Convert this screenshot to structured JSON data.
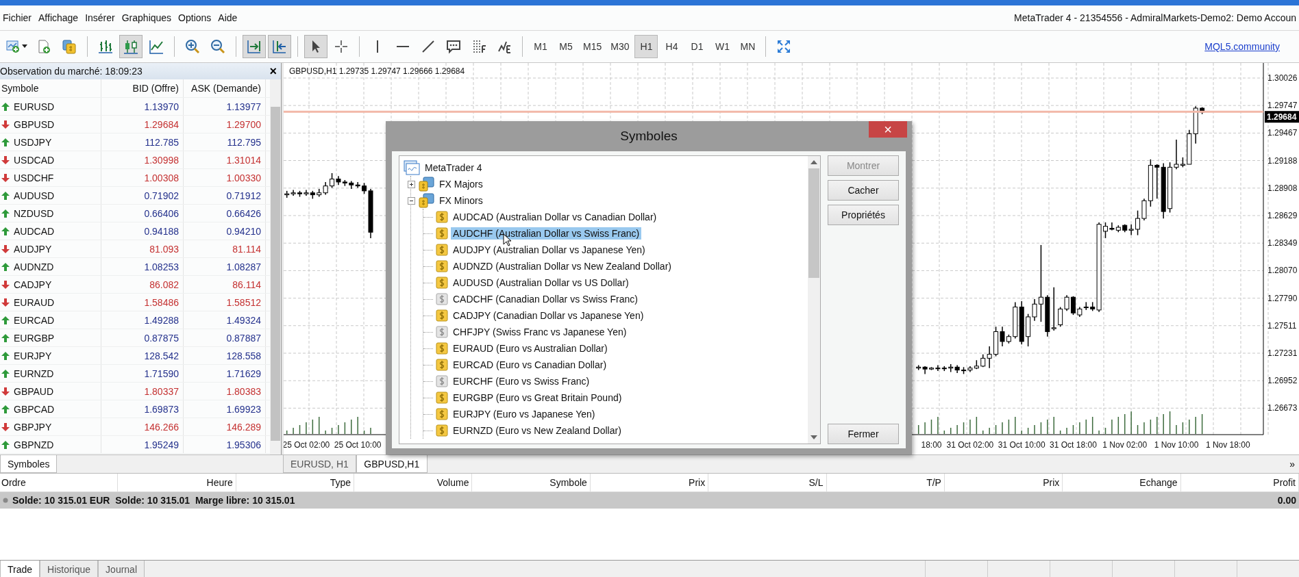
{
  "window": {
    "title": "MetaTrader 4 - 21354556 - AdmiralMarkets-Demo2: Demo Accoun"
  },
  "menu": [
    "Fichier",
    "Affichage",
    "Insérer",
    "Graphiques",
    "Options",
    "Aide"
  ],
  "toolbar": {
    "buttons": [
      {
        "selected": false
      },
      {
        "selected": false
      },
      {
        "selected": false
      },
      {
        "selected": false
      },
      {
        "selected": true
      },
      {
        "selected": false
      },
      {
        "selected": false
      },
      {
        "selected": false
      },
      {
        "selected": true
      },
      {
        "selected": true
      },
      {
        "selected": true
      },
      {
        "selected": false
      },
      {
        "selected": false
      },
      {
        "selected": false
      },
      {
        "selected": false
      },
      {
        "selected": false
      },
      {
        "selected": false
      },
      {
        "selected": false
      },
      {
        "selected": false
      }
    ],
    "timeframes": [
      {
        "label": "M1",
        "selected": false
      },
      {
        "label": "M5",
        "selected": false
      },
      {
        "label": "M15",
        "selected": false
      },
      {
        "label": "M30",
        "selected": false
      },
      {
        "label": "H1",
        "selected": true
      },
      {
        "label": "H4",
        "selected": false
      },
      {
        "label": "D1",
        "selected": false
      },
      {
        "label": "W1",
        "selected": false
      },
      {
        "label": "MN",
        "selected": false
      }
    ],
    "link": "MQL5.community"
  },
  "market_watch": {
    "title": "Observation du marché: 18:09:23",
    "close": "×",
    "columns": [
      "Symbole",
      "BID (Offre)",
      "ASK (Demande)"
    ],
    "rows": [
      {
        "symbol": "EURUSD",
        "bid": "1.13970",
        "ask": "1.13977",
        "rising": true
      },
      {
        "symbol": "GBPUSD",
        "bid": "1.29684",
        "ask": "1.29700",
        "rising": false
      },
      {
        "symbol": "USDJPY",
        "bid": "112.785",
        "ask": "112.795",
        "rising": true
      },
      {
        "symbol": "USDCAD",
        "bid": "1.30998",
        "ask": "1.31014",
        "rising": false
      },
      {
        "symbol": "USDCHF",
        "bid": "1.00308",
        "ask": "1.00330",
        "rising": false
      },
      {
        "symbol": "AUDUSD",
        "bid": "0.71902",
        "ask": "0.71912",
        "rising": true
      },
      {
        "symbol": "NZDUSD",
        "bid": "0.66406",
        "ask": "0.66426",
        "rising": true
      },
      {
        "symbol": "AUDCAD",
        "bid": "0.94188",
        "ask": "0.94210",
        "rising": true
      },
      {
        "symbol": "AUDJPY",
        "bid": "81.093",
        "ask": "81.114",
        "rising": false
      },
      {
        "symbol": "AUDNZD",
        "bid": "1.08253",
        "ask": "1.08287",
        "rising": true
      },
      {
        "symbol": "CADJPY",
        "bid": "86.082",
        "ask": "86.114",
        "rising": false
      },
      {
        "symbol": "EURAUD",
        "bid": "1.58486",
        "ask": "1.58512",
        "rising": false
      },
      {
        "symbol": "EURCAD",
        "bid": "1.49288",
        "ask": "1.49324",
        "rising": true
      },
      {
        "symbol": "EURGBP",
        "bid": "0.87875",
        "ask": "0.87887",
        "rising": true
      },
      {
        "symbol": "EURJPY",
        "bid": "128.542",
        "ask": "128.558",
        "rising": true
      },
      {
        "symbol": "EURNZD",
        "bid": "1.71590",
        "ask": "1.71629",
        "rising": true
      },
      {
        "symbol": "GBPAUD",
        "bid": "1.80337",
        "ask": "1.80383",
        "rising": false
      },
      {
        "symbol": "GBPCAD",
        "bid": "1.69873",
        "ask": "1.69923",
        "rising": true
      },
      {
        "symbol": "GBPJPY",
        "bid": "146.266",
        "ask": "146.289",
        "rising": false
      },
      {
        "symbol": "GBPNZD",
        "bid": "1.95249",
        "ask": "1.95306",
        "rising": true
      }
    ]
  },
  "left_tabs": [
    {
      "label": "Symboles",
      "selected": true
    }
  ],
  "chart": {
    "header": "GBPUSD,H1 1.29735 1.29747 1.29666 1.29684",
    "chart_data": {
      "type": "candlestick",
      "categories": [
        null,
        null,
        null,
        "25 Oct 02:00",
        null,
        null,
        null,
        null,
        null,
        null,
        null,
        "25 Oct 10:00",
        null,
        null,
        null,
        null,
        null,
        null,
        null,
        null,
        null,
        null,
        null,
        null,
        null,
        null,
        null,
        null,
        null,
        null,
        null,
        null,
        null,
        null,
        null,
        null,
        null,
        null,
        null,
        null,
        null,
        null,
        null,
        null,
        null,
        null,
        null,
        null,
        null,
        null,
        null,
        null,
        null,
        null,
        null,
        null,
        null,
        null,
        null,
        null,
        null,
        null,
        null,
        null,
        null,
        null,
        null,
        null,
        null,
        null,
        null,
        null,
        null,
        null,
        null,
        null,
        null,
        null,
        null,
        null,
        null,
        null,
        null,
        null,
        null,
        null,
        null,
        null,
        null,
        null,
        null,
        null,
        null,
        null,
        null,
        null,
        null,
        null,
        null,
        null,
        "18:00",
        null,
        null,
        null,
        null,
        null,
        "31 Oct 02:00",
        null,
        null,
        null,
        null,
        null,
        null,
        null,
        "31 Oct 10:00",
        null,
        null,
        null,
        null,
        null,
        null,
        null,
        "31 Oct 18:00",
        null,
        null,
        null,
        null,
        null,
        null,
        null,
        "1 Nov 02:00",
        null,
        null,
        null,
        null,
        null,
        null,
        null,
        "1 Nov 10:00",
        null,
        null,
        null,
        null,
        null,
        null,
        null,
        "1 Nov 18:00",
        null,
        null,
        null,
        null,
        null
      ],
      "ohlc": [
        [
          1.2884,
          1.2888,
          1.2881,
          1.2885
        ],
        [
          1.2885,
          1.2889,
          1.2883,
          1.2886
        ],
        [
          1.2886,
          1.2888,
          1.2882,
          1.2885
        ],
        [
          1.2885,
          1.2889,
          1.2883,
          1.2886
        ],
        [
          1.2886,
          1.2888,
          1.288,
          1.2884
        ],
        [
          1.2884,
          1.289,
          1.2882,
          1.2886
        ],
        [
          1.2886,
          1.2897,
          1.2884,
          1.2893
        ],
        [
          1.2893,
          1.2906,
          1.2891,
          1.29
        ],
        [
          1.29,
          1.2903,
          1.2894,
          1.2897
        ],
        [
          1.2897,
          1.2899,
          1.2893,
          1.2896
        ],
        [
          1.2896,
          1.2898,
          1.289,
          1.2894
        ],
        [
          1.2894,
          1.2897,
          1.2891,
          1.2893
        ],
        [
          1.2893,
          1.2896,
          1.2885,
          1.2888
        ],
        [
          1.2888,
          1.289,
          1.284,
          1.2846
        ],
        null,
        null,
        null,
        null,
        null,
        null,
        null,
        null,
        null,
        null,
        null,
        null,
        null,
        null,
        null,
        null,
        null,
        null,
        null,
        null,
        null,
        null,
        null,
        null,
        null,
        null,
        null,
        null,
        null,
        null,
        null,
        null,
        null,
        null,
        null,
        null,
        null,
        null,
        null,
        null,
        null,
        null,
        null,
        null,
        null,
        null,
        null,
        null,
        null,
        null,
        null,
        null,
        null,
        null,
        null,
        null,
        null,
        null,
        null,
        null,
        null,
        null,
        null,
        null,
        null,
        null,
        null,
        null,
        null,
        null,
        null,
        null,
        null,
        null,
        null,
        null,
        null,
        null,
        null,
        null,
        null,
        null,
        null,
        null,
        [
          1.2708,
          1.2711,
          1.2706,
          1.2709
        ],
        [
          1.2709,
          1.271,
          1.2702,
          1.2707
        ],
        [
          1.2707,
          1.2709,
          1.2706,
          1.2708
        ],
        [
          1.2708,
          1.2711,
          1.2705,
          1.2708
        ],
        [
          1.2708,
          1.271,
          1.2705,
          1.2708
        ],
        [
          1.2708,
          1.2712,
          1.2704,
          1.2709
        ],
        [
          1.2709,
          1.2711,
          1.2703,
          1.2706
        ],
        [
          1.2706,
          1.2709,
          1.2702,
          1.2706
        ],
        [
          1.2706,
          1.271,
          1.2704,
          1.2708
        ],
        [
          1.2708,
          1.2716,
          1.2707,
          1.271
        ],
        [
          1.271,
          1.2722,
          1.2709,
          1.2718
        ],
        [
          1.2718,
          1.273,
          1.2708,
          1.2722
        ],
        [
          1.2722,
          1.275,
          1.272,
          1.2745
        ],
        [
          1.2745,
          1.275,
          1.273,
          1.2735
        ],
        [
          1.2735,
          1.2742,
          1.2733,
          1.274
        ],
        [
          1.274,
          1.2775,
          1.2738,
          1.277
        ],
        [
          1.277,
          1.2776,
          1.2732,
          1.2735
        ],
        [
          1.274,
          1.2763,
          1.273,
          1.276
        ],
        [
          1.276,
          1.2778,
          1.2756,
          1.2773
        ],
        [
          1.2773,
          1.2833,
          1.2755,
          1.278
        ],
        [
          1.278,
          1.2782,
          1.274,
          1.2745
        ],
        [
          1.2748,
          1.279,
          1.2746,
          1.2749
        ],
        [
          1.2752,
          1.277,
          1.275,
          1.2768
        ],
        [
          1.2768,
          1.2782,
          1.2766,
          1.278
        ],
        [
          1.278,
          1.2781,
          1.2762,
          1.2764
        ],
        [
          1.2762,
          1.277,
          1.276,
          1.2768
        ],
        [
          1.277,
          1.2775,
          1.2767,
          1.277
        ],
        [
          1.277,
          1.2775,
          1.2766,
          1.2768
        ],
        [
          1.2767,
          1.2856,
          1.2765,
          1.2854
        ],
        [
          1.2847,
          1.2856,
          1.284,
          1.2852
        ],
        [
          1.285,
          1.2856,
          1.2848,
          1.2849
        ],
        [
          1.2848,
          1.2853,
          1.2846,
          1.2851
        ],
        [
          1.2853,
          1.2854,
          1.2846,
          1.2848
        ],
        [
          1.2848,
          1.2854,
          1.2843,
          1.2849
        ],
        [
          1.2849,
          1.2868,
          1.2843,
          1.286
        ],
        [
          1.286,
          1.288,
          1.2858,
          1.2878
        ],
        [
          1.2878,
          1.292,
          1.2872,
          1.2914
        ],
        [
          1.2914,
          1.2915,
          1.288,
          1.2912
        ],
        [
          1.2912,
          1.2916,
          1.286,
          1.2867
        ],
        [
          1.287,
          1.2917,
          1.2866,
          1.2912
        ],
        [
          1.2912,
          1.294,
          1.291,
          1.2915
        ],
        [
          1.2914,
          1.2922,
          1.2912,
          1.2915
        ],
        [
          1.2915,
          1.295,
          1.2915,
          1.2946
        ],
        [
          1.2946,
          1.2974,
          1.2936,
          1.2972
        ],
        [
          1.2972,
          1.2973,
          1.2966,
          1.2968
        ],
        null,
        null,
        null,
        null,
        null,
        null,
        null,
        null,
        null
      ],
      "grid": true,
      "ref_lines": [
        {
          "axis": "y",
          "value": 1.29684,
          "label": "1.29684",
          "color": "#f2b8a8"
        }
      ],
      "ylim": [
        1.26404,
        1.30179
      ],
      "yticks": [
        {
          "value": 1.30026,
          "label": "1.30026"
        },
        {
          "value": 1.29747,
          "label": "1.29747"
        },
        {
          "value": 1.29467,
          "label": "1.29467"
        },
        {
          "value": 1.29188,
          "label": "1.29188"
        },
        {
          "value": 1.28908,
          "label": "1.28908"
        },
        {
          "value": 1.28629,
          "label": "1.28629"
        },
        {
          "value": 1.28349,
          "label": "1.28349"
        },
        {
          "value": 1.2807,
          "label": "1.28070"
        },
        {
          "value": 1.2779,
          "label": "1.27790"
        },
        {
          "value": 1.27511,
          "label": "1.27511"
        },
        {
          "value": 1.27231,
          "label": "1.27231"
        },
        {
          "value": 1.26952,
          "label": "1.26952"
        },
        {
          "value": 1.26673,
          "label": "1.26673"
        }
      ]
    }
  },
  "chart_tabs": [
    {
      "label": "EURUSD, H1",
      "selected": false
    },
    {
      "label": "GBPUSD,H1",
      "selected": true
    }
  ],
  "more_tabs": "»",
  "dialog": {
    "title": "Symboles",
    "close": "×",
    "tree": {
      "label": "MetaTrader 4",
      "children": [
        {
          "label": "FX Majors",
          "expanded": false
        },
        {
          "label": "FX Minors",
          "expanded": true,
          "children": [
            {
              "label": "AUDCAD (Australian Dollar vs Canadian Dollar)",
              "visible": true,
              "selected": false
            },
            {
              "label": "AUDCHF (Australian Dollar vs Swiss Franc)",
              "visible": true,
              "selected": true
            },
            {
              "label": "AUDJPY (Australian Dollar vs Japanese Yen)",
              "visible": true,
              "selected": false
            },
            {
              "label": "AUDNZD (Australian Dollar vs New Zealand Dollar)",
              "visible": true,
              "selected": false
            },
            {
              "label": "AUDUSD (Australian Dollar vs US Dollar)",
              "visible": true,
              "selected": false
            },
            {
              "label": "CADCHF (Canadian Dollar vs Swiss Franc)",
              "visible": false,
              "selected": false
            },
            {
              "label": "CADJPY (Canadian Dollar vs Japanese Yen)",
              "visible": true,
              "selected": false
            },
            {
              "label": "CHFJPY (Swiss Franc vs Japanese Yen)",
              "visible": false,
              "selected": false
            },
            {
              "label": "EURAUD (Euro vs Australian Dollar)",
              "visible": true,
              "selected": false
            },
            {
              "label": "EURCAD (Euro vs Canadian Dollar)",
              "visible": true,
              "selected": false
            },
            {
              "label": "EURCHF (Euro vs Swiss Franc)",
              "visible": false,
              "selected": false
            },
            {
              "label": "EURGBP (Euro vs Great Britain Pound)",
              "visible": true,
              "selected": false
            },
            {
              "label": "EURJPY (Euro vs Japanese Yen)",
              "visible": true,
              "selected": false
            },
            {
              "label": "EURNZD (Euro vs New Zealand Dollar)",
              "visible": true,
              "selected": false
            }
          ]
        }
      ]
    },
    "buttons": [
      {
        "label": "Montrer",
        "disabled": true
      },
      {
        "label": "Cacher",
        "disabled": false
      },
      {
        "label": "Propriétés",
        "disabled": false
      }
    ],
    "close_button": "Fermer"
  },
  "terminal": {
    "columns": [
      "Ordre",
      "Heure",
      "Type",
      "Volume",
      "Symbole",
      "Prix",
      "S/L",
      "T/P",
      "Prix",
      "Echange",
      "Profit"
    ],
    "balance": {
      "text": "Solde: 10 315.01 EUR  Solde: 10 315.01  Marge libre: 10 315.01",
      "profit": "0.00"
    },
    "tabs": [
      {
        "label": "Trade",
        "selected": true
      },
      {
        "label": "Historique",
        "selected": false
      },
      {
        "label": "Journal",
        "selected": false
      }
    ]
  }
}
